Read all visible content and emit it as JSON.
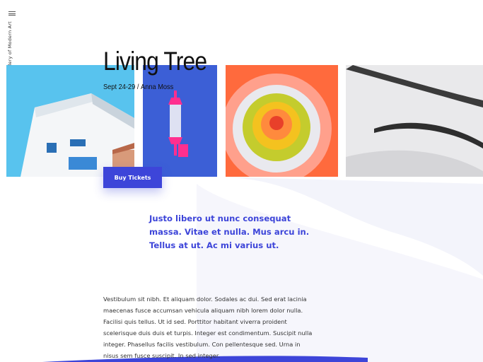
{
  "sidebar": {
    "site_name": "Gallery of Modern Art",
    "menu_icon": "hamburger-menu-icon"
  },
  "exhibition": {
    "title": "Living Tree",
    "dates": "Sept 24-29",
    "separator": "/",
    "artist": "Anna Moss",
    "buy_label": "Buy Tickets"
  },
  "content": {
    "lead": "Justo libero ut nunc consequat massa. Vitae et nulla. Mus arcu in. Tellus at ut. Ac mi varius ut.",
    "body": "Vestibulum sit nibh. Et aliquam dolor. Sodales ac dui. Sed erat lacinia maecenas fusce accumsan vehicula aliquam nibh lorem dolor nulla. Facilisi quis tellus. Ut id sed. Porttitor habitant viverra proident scelerisque duis duis et turpis. Integer est condimentum. Suscipit nulla integer. Phasellus facilis vestibulum. Con pellentesque sed. Urna in nisus sem fusce suscipit. In sed integer."
  },
  "colors": {
    "accent": "#3d45d9",
    "wave": "#f3f4fb"
  },
  "gallery": [
    {
      "icon": "building-photo"
    },
    {
      "icon": "pink-lamp-photo"
    },
    {
      "icon": "concentric-art-photo"
    },
    {
      "icon": "museum-architecture-photo"
    }
  ]
}
